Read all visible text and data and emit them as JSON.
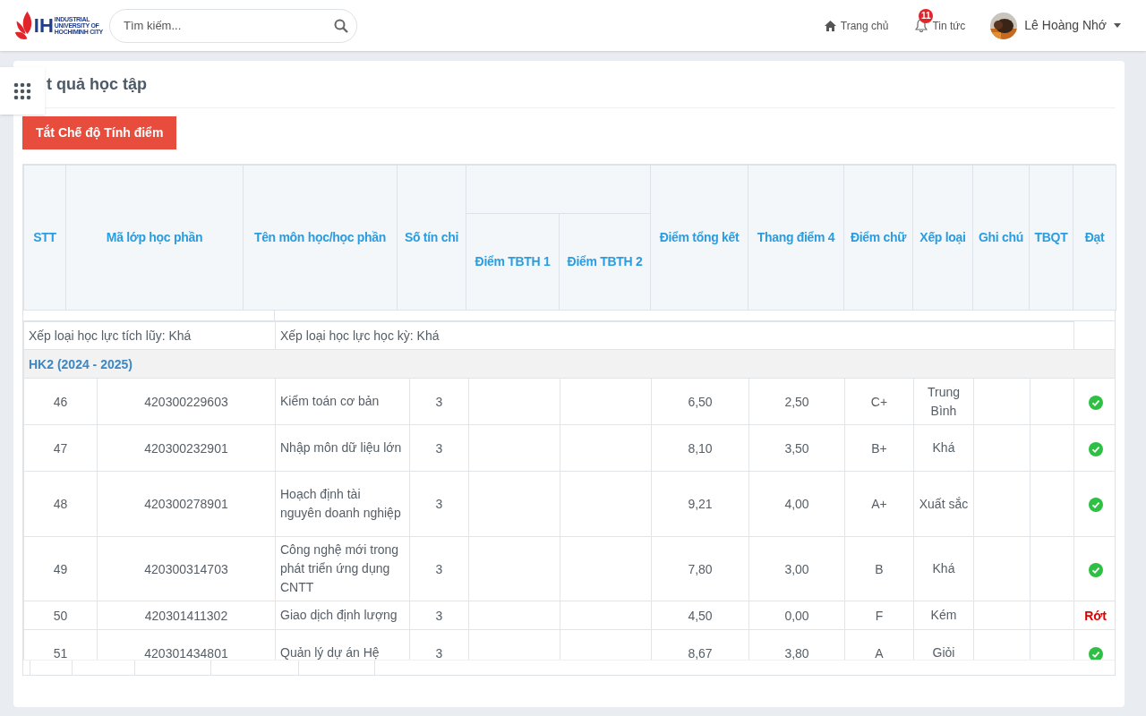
{
  "header": {
    "logo": {
      "mark": "IH",
      "lines": [
        "INDUSTRIAL",
        "UNIVERSITY OF",
        "HOCHIMINH CITY"
      ]
    },
    "search": {
      "placeholder": "Tìm kiếm..."
    },
    "nav": [
      {
        "kind": "home",
        "label": "Trang chủ"
      },
      {
        "kind": "news",
        "label": "Tin tức",
        "badge": "11"
      }
    ],
    "user": {
      "name": "Lê Hoàng Nhớ"
    }
  },
  "page": {
    "title": "t quả học tập",
    "toggle_button": "Tắt Chế độ Tính điểm"
  },
  "table": {
    "columns": [
      "STT",
      "Mã lớp học phần",
      "Tên môn học/học phần",
      "Số tín chỉ",
      {
        "children": [
          "Điểm TBTH 1",
          "Điểm TBTH 2"
        ]
      },
      "Điểm tổng kết",
      "Thang điểm 4",
      "Điểm chữ",
      "Xếp loại",
      "Ghi chú",
      "TBQT",
      "Đạt"
    ],
    "summary": [
      "Xếp loại học lực tích lũy: Khá",
      "Xếp loại học lực học kỳ: Khá"
    ],
    "semester": "HK2 (2024 - 2025)",
    "rows": [
      {
        "stt": "46",
        "code": "420300229603",
        "name": "Kiểm toán cơ bản",
        "credits": "3",
        "total": "6,50",
        "scale4": "2,50",
        "letter": "C+",
        "rank": "Trung Bình",
        "passed": true
      },
      {
        "stt": "47",
        "code": "420300232901",
        "name": "Nhập môn dữ liệu lớn",
        "credits": "3",
        "total": "8,10",
        "scale4": "3,50",
        "letter": "B+",
        "rank": "Khá",
        "passed": true
      },
      {
        "stt": "48",
        "code": "420300278901",
        "name": "Hoạch định tài nguyên doanh nghiệp",
        "credits": "3",
        "total": "9,21",
        "scale4": "4,00",
        "letter": "A+",
        "rank": "Xuất sắc",
        "passed": true
      },
      {
        "stt": "49",
        "code": "420300314703",
        "name": "Công nghệ mới trong phát triển ứng dụng CNTT",
        "credits": "3",
        "total": "7,80",
        "scale4": "3,00",
        "letter": "B",
        "rank": "Khá",
        "passed": true
      },
      {
        "stt": "50",
        "code": "420301411302",
        "name": "Giao dịch định lượng",
        "credits": "3",
        "total": "4,50",
        "scale4": "0,00",
        "letter": "F",
        "rank": "Kém",
        "passed": false,
        "result": "Rớt"
      },
      {
        "stt": "51",
        "code": "420301434801",
        "name": "Quản lý dự án Hệ",
        "credits": "3",
        "total": "8,67",
        "scale4": "3,80",
        "letter": "A",
        "rank": "Giỏi",
        "passed": true
      }
    ]
  }
}
